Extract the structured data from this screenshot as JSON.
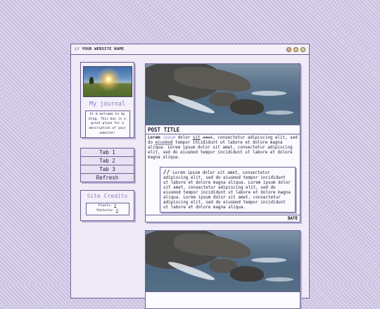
{
  "window": {
    "title": "// YOUR WEBSITE NAME",
    "controls": [
      "minimize",
      "maximize",
      "close"
    ]
  },
  "sidebar": {
    "journal_title": "My journal",
    "journal_description": "hi & welcome to my blog. This box is a great place for a description of your website!",
    "tabs": [
      {
        "label": "Tab 1"
      },
      {
        "label": "Tab 2"
      },
      {
        "label": "Tab 3"
      },
      {
        "label": "Refresh"
      }
    ],
    "credits": {
      "title": "Site Credits",
      "pixels_label": "Pixels:",
      "pixels_link": "X",
      "patterns_label": "Patterns:",
      "patterns_link": "X"
    }
  },
  "post": {
    "title": "POST TITLE",
    "body_lead": "Lorem",
    "body_italic": "ipsum",
    "body_word1": "dolor",
    "body_underline": "sit",
    "body_strike": "amet",
    "body_rest_a": ", consectetur adipiscing elit, sed do",
    "body_dotted": "eiusmod",
    "body_rest_b": "tempor incididunt ut labore et dolore magna aliqua. Lorem ipsum dolor sit amet, consectetur adipiscing elit, sed do eiusmod tempor incididunt ut labore et dolore magna aliqua.",
    "quote_mark": "//",
    "quote_text": "Lorem ipsum dolor sit amet, consectetur adipiscing elit, sed do eiusmod tempor incididunt ut labore et dolore magna aliqua. Lorem ipsum dolor sit amet, consectetur adipiscing elit, sed do eiusmod tempor incididunt ut labore et dolore magna aliqua. Lorem ipsum dolor sit amet, consectetur adipiscing elit, sed do eiusmod tempor incididunt ut labore et dolore magna aliqua.",
    "date": "DATE"
  },
  "colors": {
    "accent": "#8f80c2",
    "border": "#6c5f96",
    "background": "#d9d2ea"
  }
}
